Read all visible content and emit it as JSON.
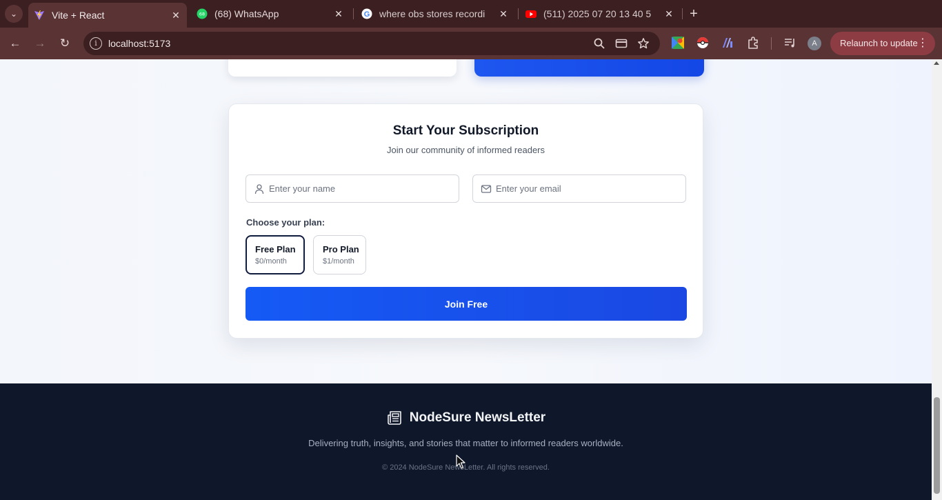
{
  "browser": {
    "tabs": [
      {
        "title": "Vite + React",
        "active": true,
        "favicon": "vite-icon"
      },
      {
        "title": "(68) WhatsApp",
        "active": false,
        "favicon": "whatsapp-icon"
      },
      {
        "title": "where obs stores recordi",
        "active": false,
        "favicon": "google-icon"
      },
      {
        "title": "(511) 2025 07 20 13 40 5",
        "active": false,
        "favicon": "youtube-icon"
      }
    ],
    "url": "localhost:5173",
    "relaunch_label": "Relaunch to update",
    "profile_initial": "A"
  },
  "page": {
    "subscription": {
      "title": "Start Your Subscription",
      "subtitle": "Join our community of informed readers",
      "name_placeholder": "Enter your name",
      "email_placeholder": "Enter your email",
      "plan_label": "Choose your plan:",
      "plans": [
        {
          "name": "Free Plan",
          "price": "$0/month",
          "selected": true
        },
        {
          "name": "Pro Plan",
          "price": "$1/month",
          "selected": false
        }
      ],
      "submit_label": "Join Free"
    },
    "footer": {
      "brand": "NodeSure NewsLetter",
      "tagline": "Delivering truth, insights, and stories that matter to informed readers worldwide.",
      "copyright": "© 2024 NodeSure NewsLetter. All rights reserved."
    }
  },
  "colors": {
    "accent": "#1b4fef",
    "footer_bg": "#0f172a",
    "chrome_bg": "#5a3335"
  }
}
